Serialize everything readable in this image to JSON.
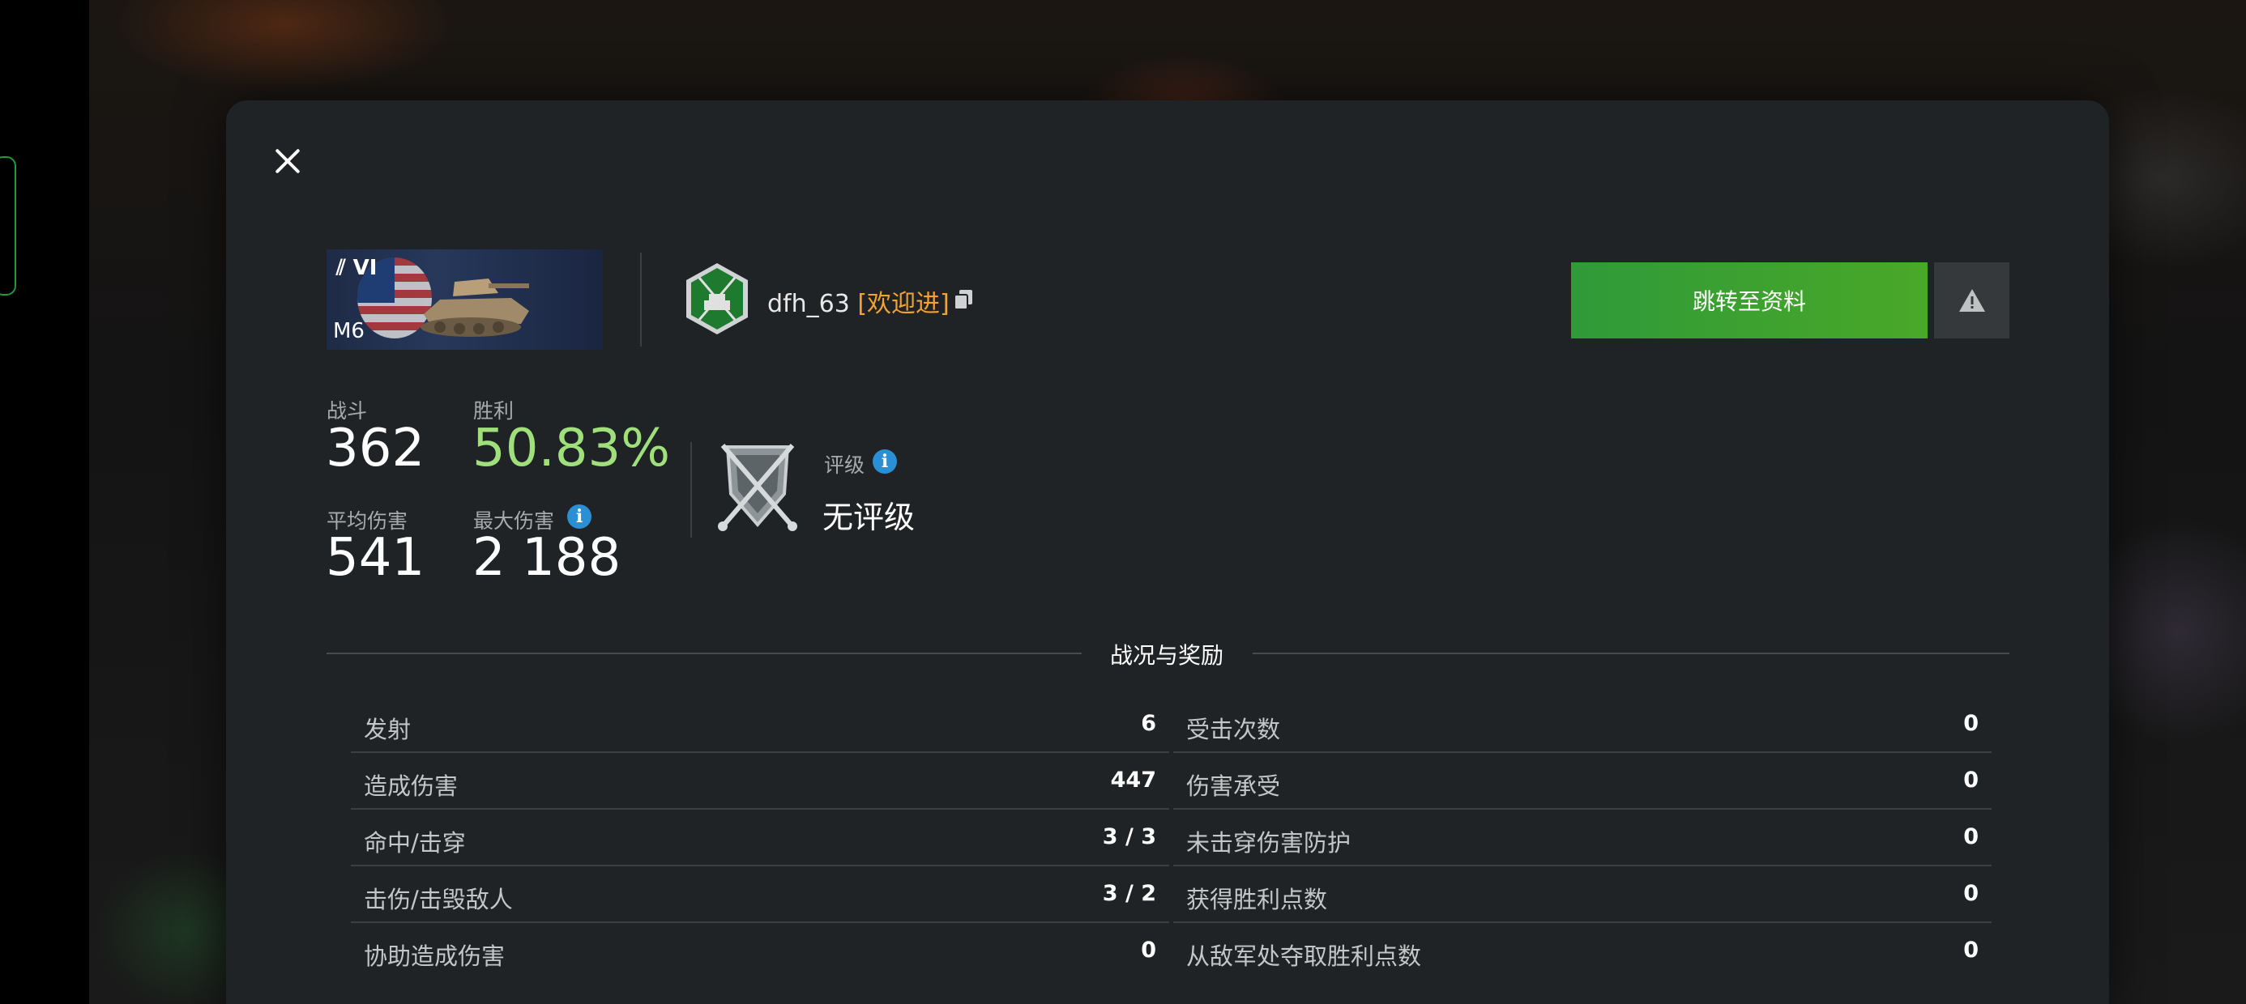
{
  "vehicle": {
    "tier": "VI",
    "name": "M6"
  },
  "player": {
    "name": "dfh_63",
    "clan_tag": "[欢迎进]"
  },
  "actions": {
    "goto_profile_label": "跳转至资料"
  },
  "stats": {
    "battles_label": "战斗",
    "battles_value": "362",
    "wins_label": "胜利",
    "wins_value": "50.83%",
    "avg_damage_label": "平均伤害",
    "avg_damage_value": "541",
    "max_damage_label": "最大伤害",
    "max_damage_value": "2 188"
  },
  "rating": {
    "label": "评级",
    "value": "无评级"
  },
  "section": {
    "title": "战况与奖励"
  },
  "table_left": [
    {
      "label": "发射",
      "value": "6"
    },
    {
      "label": "造成伤害",
      "value": "447"
    },
    {
      "label": "命中/击穿",
      "value": "3 / 3"
    },
    {
      "label": "击伤/击毁敌人",
      "value": "3 / 2"
    },
    {
      "label": "协助造成伤害",
      "value": "0"
    }
  ],
  "table_right": [
    {
      "label": "受击次数",
      "value": "0"
    },
    {
      "label": "伤害承受",
      "value": "0"
    },
    {
      "label": "未击穿伤害防护",
      "value": "0"
    },
    {
      "label": "获得胜利点数",
      "value": "0"
    },
    {
      "label": "从敌军处夺取胜利点数",
      "value": "0"
    }
  ],
  "colors": {
    "accent_green": "#3fa331",
    "win_rate": "#9fe07c",
    "clan_tag": "#f2a230",
    "info_blue": "#2b8fd6",
    "panel_bg": "#1f2325"
  },
  "icons": [
    "close-icon",
    "copy-icon",
    "warning-icon",
    "info-icon",
    "clan-emblem-icon",
    "rating-shield-icon",
    "tier-chevron-icon",
    "nation-flag-icon",
    "tank-icon"
  ]
}
